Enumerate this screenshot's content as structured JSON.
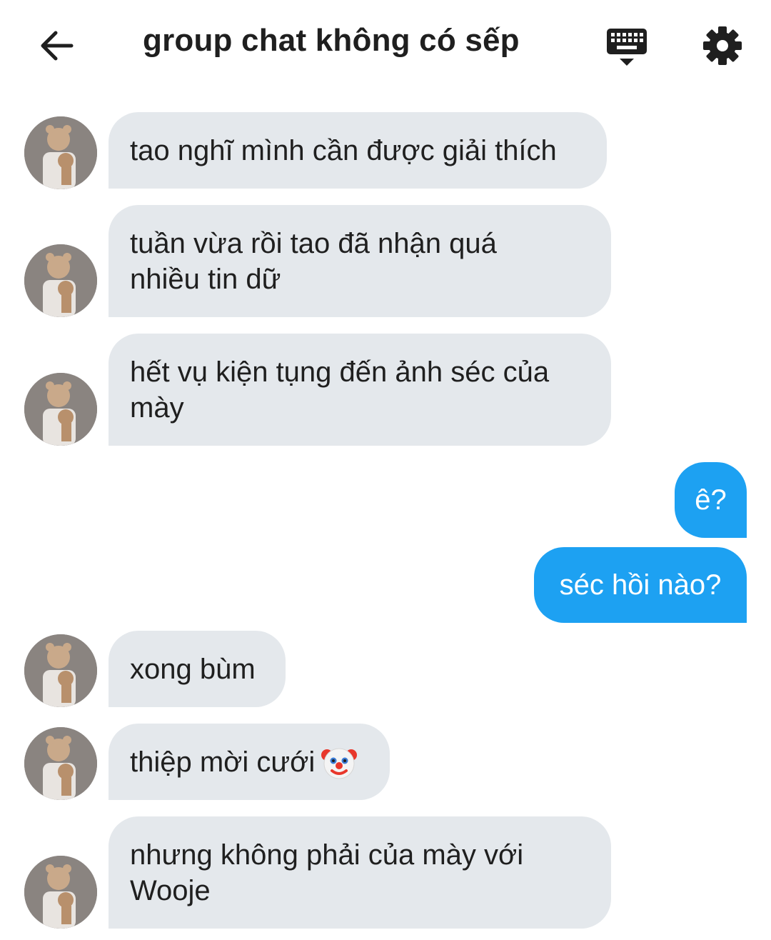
{
  "header": {
    "title": "group chat không có sếp",
    "back_icon": "arrow-left-icon",
    "keyboard_icon": "keyboard-hide-icon",
    "settings_icon": "gear-icon"
  },
  "colors": {
    "incoming_bubble": "#e4e8ec",
    "outgoing_bubble": "#1da1f2",
    "text": "#1f1f1f"
  },
  "messages": [
    {
      "direction": "incoming",
      "text": "tao nghĩ mình cần được giải thích"
    },
    {
      "direction": "incoming",
      "text": "tuần vừa rồi tao đã nhận quá nhiều tin dữ"
    },
    {
      "direction": "incoming",
      "text": "hết vụ kiện tụng đến ảnh séc của mày"
    },
    {
      "direction": "outgoing",
      "text": "ê?"
    },
    {
      "direction": "outgoing",
      "text": "séc hồi nào?"
    },
    {
      "direction": "incoming",
      "text": "xong bùm"
    },
    {
      "direction": "incoming",
      "text": "thiệp mời cưới",
      "emoji": "clown-face"
    },
    {
      "direction": "incoming",
      "text": "nhưng không phải của mày với Wooje"
    }
  ]
}
